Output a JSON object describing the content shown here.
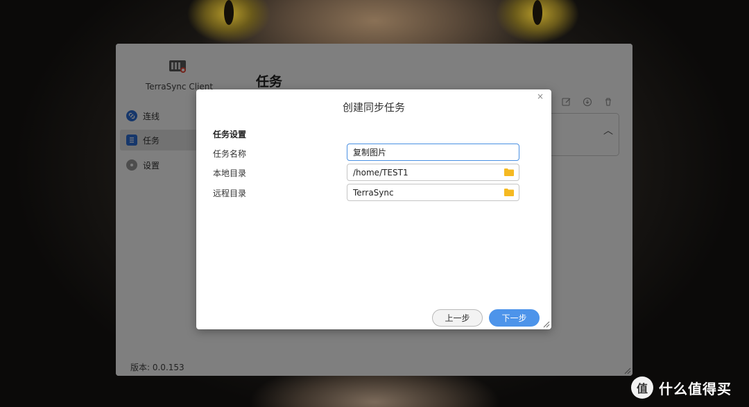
{
  "app": {
    "title": "TerraSync Client",
    "heading": "任务",
    "version": "版本: 0.0.153",
    "sidebar": {
      "items": [
        {
          "label": "连线",
          "icon": "link-icon"
        },
        {
          "label": "任务",
          "icon": "task-list-icon",
          "active": true
        },
        {
          "label": "设置",
          "icon": "gear-icon"
        }
      ]
    },
    "toolbar": {
      "icons": [
        "edit-icon",
        "sync-icon",
        "delete-icon"
      ]
    }
  },
  "dialog": {
    "title": "创建同步任务",
    "close_label": "×",
    "section_title": "任务设置",
    "fields": {
      "task_name": {
        "label": "任务名称",
        "value": "复制图片"
      },
      "local_dir": {
        "label": "本地目录",
        "value": "/home/TEST1"
      },
      "remote_dir": {
        "label": "远程目录",
        "value": "TerraSync"
      }
    },
    "buttons": {
      "prev": "上一步",
      "next": "下一步"
    }
  },
  "watermark": {
    "badge": "值",
    "text": "什么值得买"
  },
  "colors": {
    "accent": "#4d94ea",
    "folder": "#f5b921",
    "overlay": "rgba(0,0,0,0.5)"
  }
}
